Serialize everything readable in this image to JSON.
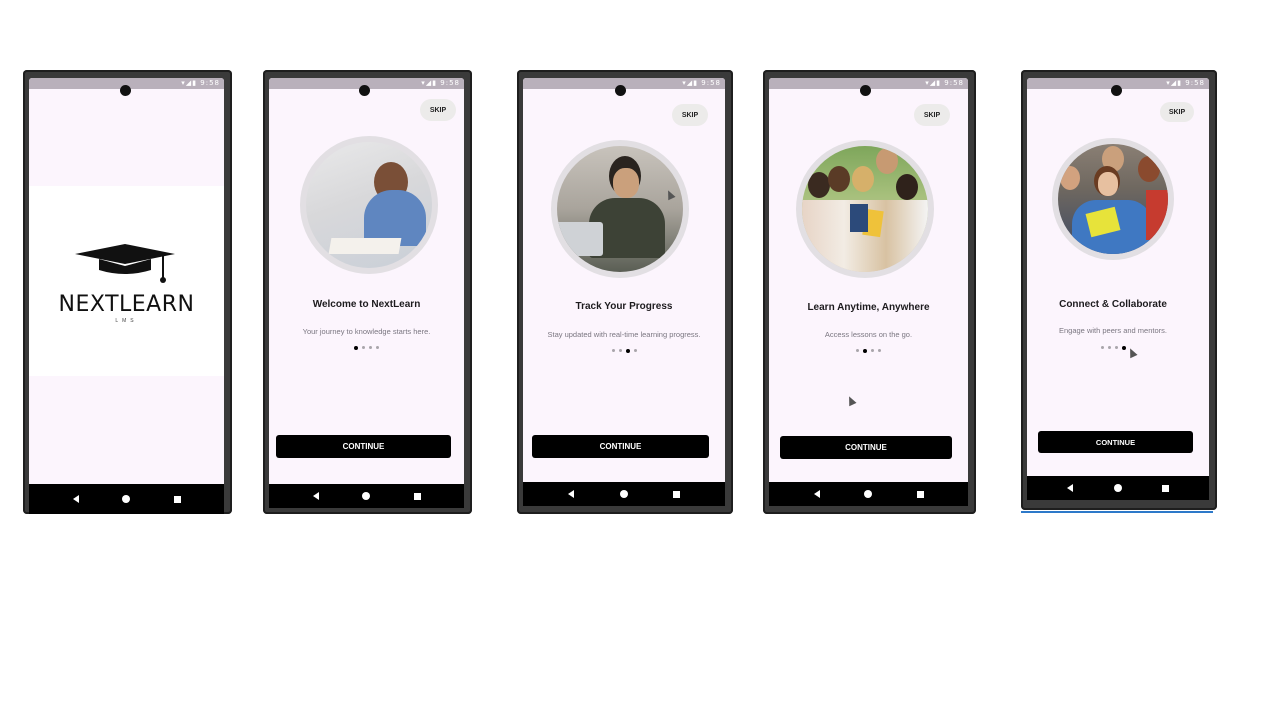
{
  "status_icons": "▾◢▮ 9:58",
  "splash": {
    "brand": "NEXTLEARN",
    "brand_sub": "LMS"
  },
  "onboarding": [
    {
      "skip_label": "SKIP",
      "title": "Welcome to NextLearn",
      "subtitle": "Your journey to knowledge starts here.",
      "active_dot": 0,
      "button_label": "CONTINUE"
    },
    {
      "skip_label": "SKIP",
      "title": "Track Your Progress",
      "subtitle": "Stay updated with real-time learning progress.",
      "active_dot": 2,
      "button_label": "CONTINUE"
    },
    {
      "skip_label": "SKIP",
      "title": "Learn Anytime, Anywhere",
      "subtitle": "Access lessons on the go.",
      "active_dot": 1,
      "button_label": "CONTINUE"
    },
    {
      "skip_label": "SKIP",
      "title": "Connect & Collaborate",
      "subtitle": "Engage with peers and mentors.",
      "active_dot": 3,
      "button_label": "CONTINUE"
    }
  ],
  "icons": {
    "status": "status-icons",
    "camera": "camera-icon",
    "back": "back-nav-icon",
    "home": "home-nav-icon",
    "recent": "recents-nav-icon",
    "logo": "graduation-cap-icon",
    "cursor": "mouse-cursor-icon"
  },
  "colors": {
    "screen_bg": "#fcf5fd",
    "button_bg": "#000000",
    "skip_bg": "#ecebea",
    "status_bar": "#b9b0bb"
  }
}
